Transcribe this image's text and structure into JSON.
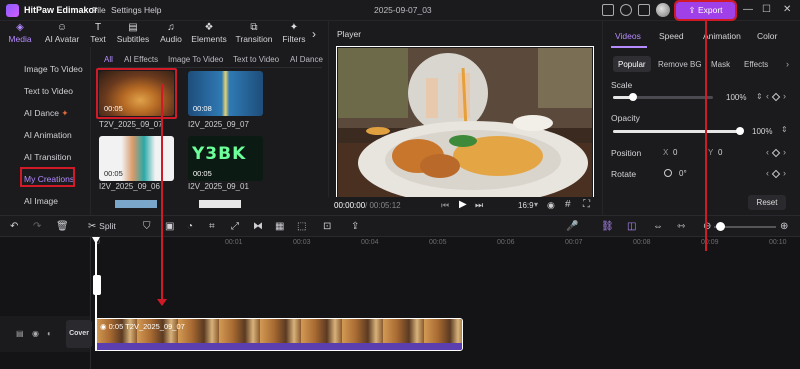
{
  "app": {
    "name": "HitPaw Edimakor",
    "menus": [
      "File",
      "Settings",
      "Help"
    ],
    "project": "2025-09-07_03",
    "export_label": "Export"
  },
  "top_tabs": [
    {
      "label": "Media",
      "icon": "media-icon"
    },
    {
      "label": "AI Avatar",
      "icon": "avatar-icon"
    },
    {
      "label": "Text",
      "icon": "text-icon"
    },
    {
      "label": "Subtitles",
      "icon": "subtitles-icon"
    },
    {
      "label": "Audio",
      "icon": "music-icon"
    },
    {
      "label": "Elements",
      "icon": "elements-icon"
    },
    {
      "label": "Transition",
      "icon": "transition-icon"
    },
    {
      "label": "Filters",
      "icon": "filters-icon"
    }
  ],
  "left_nav": [
    "Image To Video",
    "Text to Video",
    "AI Dance",
    "AI Animation",
    "AI Transition",
    "My Creations",
    "AI Image"
  ],
  "media_tabs": [
    "All",
    "AI Effects",
    "Image To Video",
    "Text to Video",
    "AI Dance"
  ],
  "media_items": [
    {
      "duration": "00:05",
      "name": "T2V_2025_09_07"
    },
    {
      "duration": "00:08",
      "name": "I2V_2025_09_07"
    },
    {
      "duration": "00:05",
      "name": "I2V_2025_09_06"
    },
    {
      "duration": "00:05",
      "name": "I2V_2025_09_01"
    }
  ],
  "player": {
    "title": "Player",
    "current": "00:00:00",
    "total": "/ 00:05:12",
    "ratio": "16:9"
  },
  "right_panel": {
    "tabs": [
      "Videos",
      "Speed",
      "Animation",
      "Color"
    ],
    "subtabs": [
      "Popular",
      "Remove BG",
      "Mask",
      "Effects"
    ],
    "scale_label": "Scale",
    "scale_value": "100%",
    "opacity_label": "Opacity",
    "opacity_value": "100%",
    "position_label": "Position",
    "pos_x_label": "X",
    "pos_x": "0",
    "pos_y_label": "Y",
    "pos_y": "0",
    "rotate_label": "Rotate",
    "rotate_value": "0°",
    "reset_label": "Reset"
  },
  "toolbar": {
    "split_label": "Split"
  },
  "ruler": [
    "00:01",
    "00:03",
    "00:04",
    "00:05",
    "00:06",
    "00:07",
    "00:08",
    "00:09",
    "00:10"
  ],
  "ruler_start": "0",
  "timeline": {
    "cover_label": "Cover",
    "clip_label": "0:05 T2V_2025_09_07"
  }
}
